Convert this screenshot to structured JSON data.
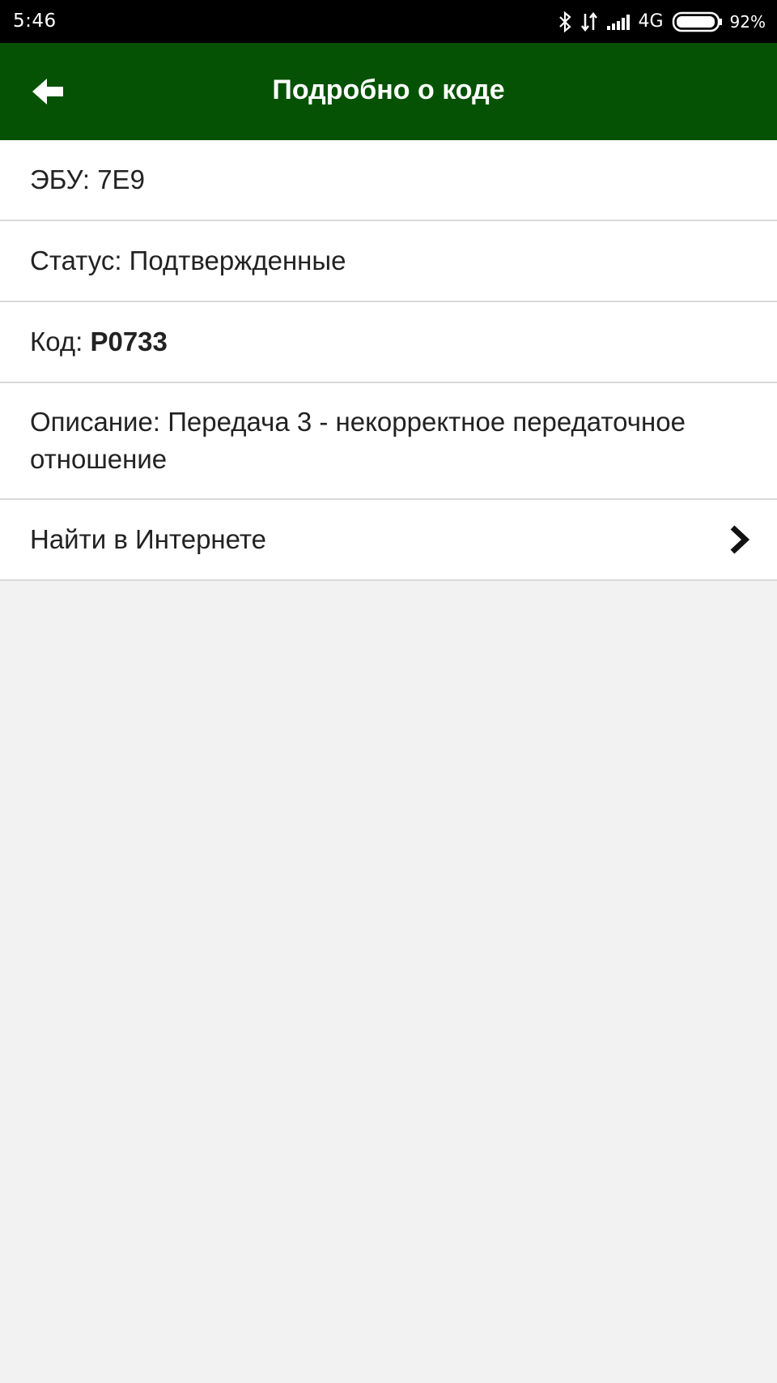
{
  "status_bar": {
    "time": "5:46",
    "network": "4G",
    "battery": "92%",
    "icons": [
      "bluetooth-icon",
      "data-transfer-icon",
      "signal-icon",
      "battery-icon"
    ]
  },
  "app_bar": {
    "title": "Подробно о коде",
    "color": "#055205",
    "back_icon": "back-arrow-icon"
  },
  "details": {
    "ecu_label": "ЭБУ:",
    "ecu_value": "7E9",
    "status_label": "Статус:",
    "status_value": "Подтвержденные",
    "code_label": "Код:",
    "code_value": "P0733",
    "description_label": "Описание:",
    "description_value": "Передача 3 - некорректное передаточное отношение",
    "search_label": "Найти в Интернете",
    "search_icon": "chevron-right-icon"
  }
}
